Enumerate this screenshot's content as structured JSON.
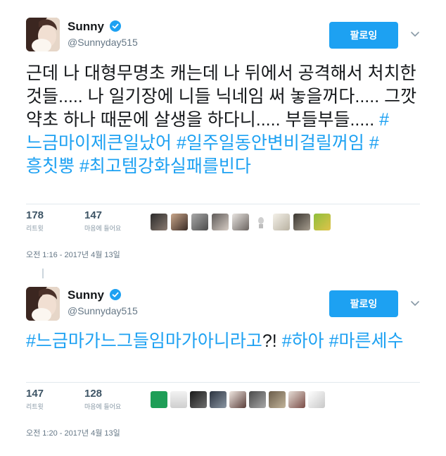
{
  "tweets": [
    {
      "user": {
        "name": "Sunny",
        "handle": "@Sunnyday515"
      },
      "follow_label": "팔로잉",
      "text_plain": "근데 나 대형무명초 캐는데 나 뒤에서 공격해서 처치한 것들..... 나 일기장에 니들 닉네임 써 놓을꺼다..... 그깟 약초 하나 때문에 살생을 하다니..... 부들부들..... ",
      "hashtags": [
        "#느금마이제큰일났어",
        "#일주일동안변비걸릴꺼임",
        "#흥칫뿡",
        "#최고템강화실패를빈다"
      ],
      "retweets": {
        "count": "178",
        "label": "리트윗"
      },
      "likes": {
        "count": "147",
        "label": "마음에 들어요"
      },
      "timestamp": "오전 1:16 - 2017년 4월 13일",
      "likers": [
        "liker-1",
        "liker-2",
        "liker-3",
        "liker-4",
        "liker-5",
        "liker-6",
        "liker-7",
        "liker-8",
        "liker-9"
      ]
    },
    {
      "user": {
        "name": "Sunny",
        "handle": "@Sunnyday515"
      },
      "follow_label": "팔로잉",
      "text_parts": [
        {
          "text": "#느금마가느그들임마가아니라고",
          "hashtag": true
        },
        {
          "text": "?! ",
          "hashtag": false
        },
        {
          "text": "#하아",
          "hashtag": true
        },
        {
          "text": " ",
          "hashtag": false
        },
        {
          "text": "#마른세수",
          "hashtag": true
        }
      ],
      "retweets": {
        "count": "147",
        "label": "리트윗"
      },
      "likes": {
        "count": "128",
        "label": "마음에 들어요"
      },
      "timestamp": "오전 1:20 - 2017년 4월 13일",
      "likers": [
        "liker-1",
        "liker-2",
        "liker-3",
        "liker-4",
        "liker-5",
        "liker-6",
        "liker-7",
        "liker-8",
        "liker-9",
        "liker-10"
      ]
    }
  ],
  "colors": {
    "accent": "#1da1f2",
    "text": "#14171a",
    "muted": "#657786",
    "divider": "#e1e8ed"
  },
  "icons": {
    "verified": "verified-badge-icon",
    "menu": "chevron-down-icon"
  }
}
